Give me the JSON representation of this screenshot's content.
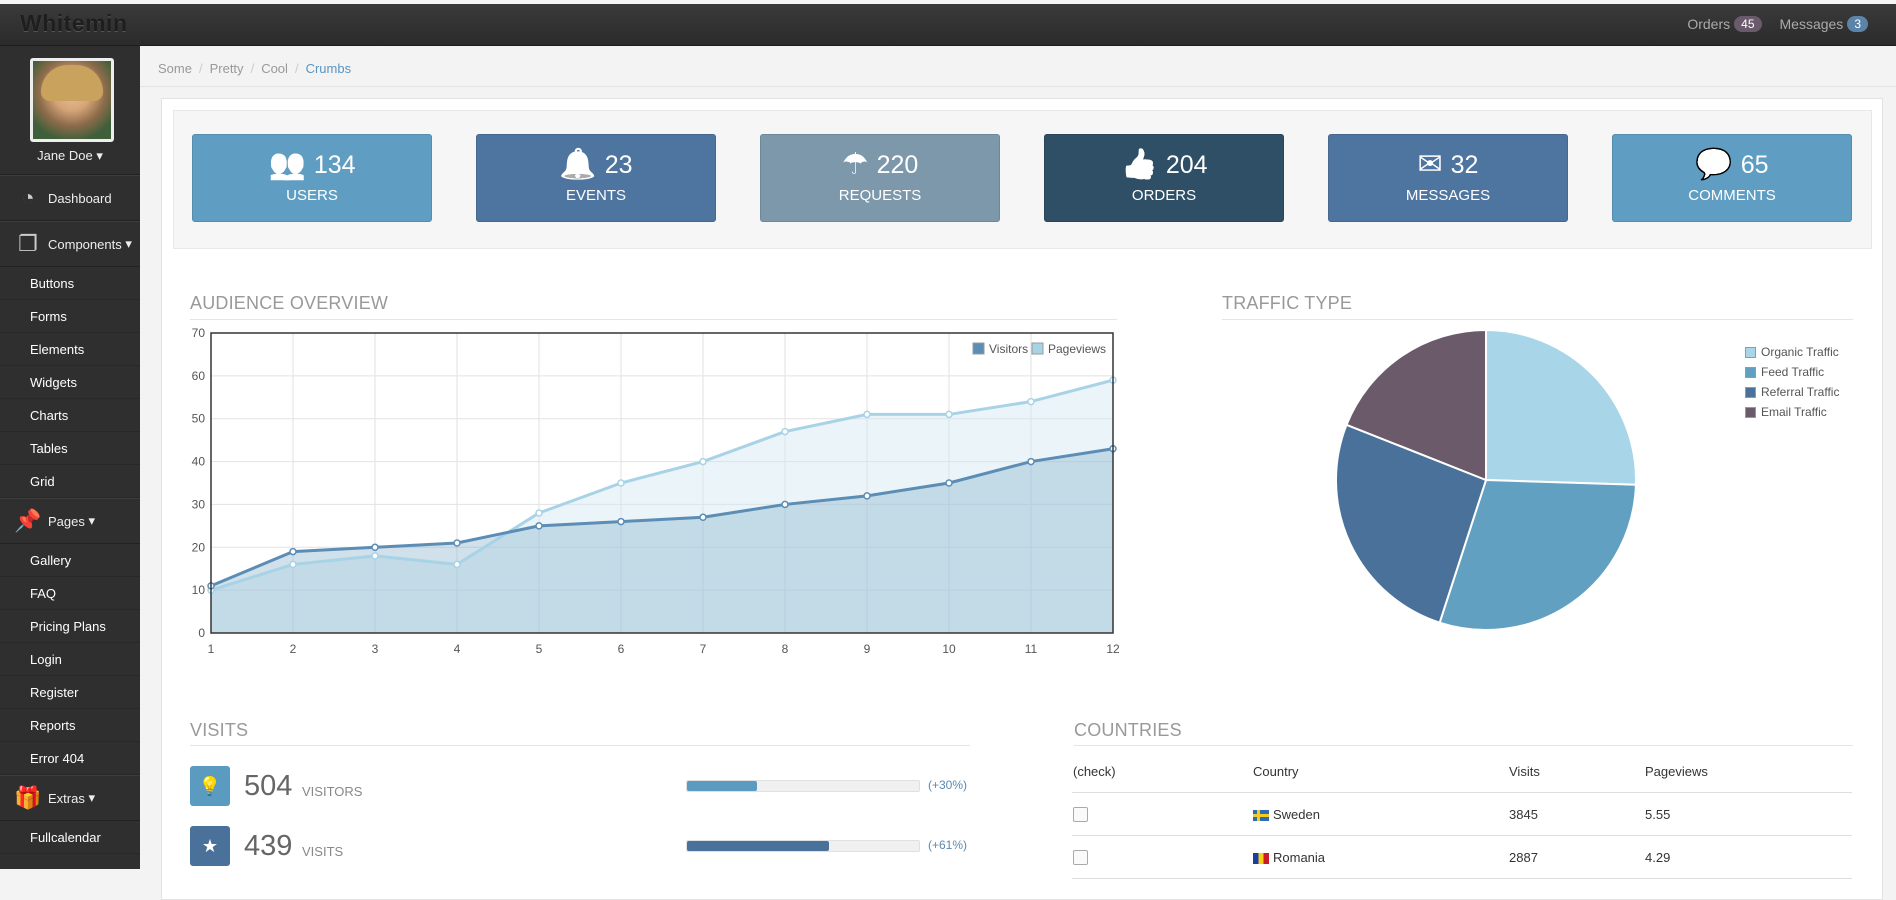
{
  "app": {
    "title": "Whitemin"
  },
  "topnav": {
    "orders": {
      "label": "Orders",
      "count": "45"
    },
    "messages": {
      "label": "Messages",
      "count": "3"
    }
  },
  "sidebar": {
    "user": "Jane Doe",
    "dashboard": "Dashboard",
    "components": "Components",
    "components_items": [
      "Buttons",
      "Forms",
      "Elements",
      "Widgets",
      "Charts",
      "Tables",
      "Grid"
    ],
    "pages": "Pages",
    "pages_items": [
      "Gallery",
      "FAQ",
      "Pricing Plans",
      "Login",
      "Register",
      "Reports",
      "Error 404"
    ],
    "extras": "Extras",
    "extras_items": [
      "Fullcalendar"
    ]
  },
  "breadcrumb": [
    "Some",
    "Pretty",
    "Cool",
    "Crumbs"
  ],
  "stats": [
    {
      "value": "134",
      "label": "USERS",
      "icon": "users-icon",
      "color": "#5f9dc2"
    },
    {
      "value": "23",
      "label": "EVENTS",
      "icon": "bell-icon",
      "color": "#4e74a0"
    },
    {
      "value": "220",
      "label": "REQUESTS",
      "icon": "umbrella-icon",
      "color": "#7c98aa"
    },
    {
      "value": "204",
      "label": "ORDERS",
      "icon": "thumbs-up-icon",
      "color": "#2e4f66"
    },
    {
      "value": "32",
      "label": "MESSAGES",
      "icon": "envelope-icon",
      "color": "#4e74a0"
    },
    {
      "value": "65",
      "label": "COMMENTS",
      "icon": "comments-icon",
      "color": "#5f9dc2"
    }
  ],
  "audience": {
    "title": "AUDIENCE OVERVIEW",
    "chart_data": {
      "type": "area",
      "x": [
        1,
        2,
        3,
        4,
        5,
        6,
        7,
        8,
        9,
        10,
        11,
        12
      ],
      "ylim": [
        0,
        70
      ],
      "yticks": [
        0,
        10,
        20,
        30,
        40,
        50,
        60,
        70
      ],
      "series": [
        {
          "name": "Visitors",
          "values": [
            11,
            19,
            20,
            21,
            25,
            26,
            27,
            30,
            32,
            35,
            40,
            43
          ],
          "color": "#5b8db5"
        },
        {
          "name": "Pageviews",
          "values": [
            10,
            16,
            18,
            16,
            28,
            35,
            40,
            47,
            51,
            51,
            54,
            59
          ],
          "color": "#a8d3e6"
        }
      ],
      "legend": "top-right",
      "grid": true
    }
  },
  "traffic": {
    "title": "TRAFFIC TYPE",
    "chart_data": {
      "type": "pie",
      "labels": [
        "Organic Traffic",
        "Feed Traffic",
        "Referral Traffic",
        "Email Traffic"
      ],
      "values": [
        25.5,
        29.5,
        26,
        19
      ],
      "colors": [
        "#a8d6e8",
        "#62a0c2",
        "#4a7199",
        "#6b5a69"
      ],
      "legend": "top-right"
    }
  },
  "visits": {
    "title": "VISITS",
    "rows": [
      {
        "value": "504",
        "label": "VISITORS",
        "pct": "(+30%)",
        "fill": 0.3,
        "icon": "lightbulb-icon",
        "color": "#5b9bbf"
      },
      {
        "value": "439",
        "label": "VISITS",
        "pct": "(+61%)",
        "fill": 0.61,
        "icon": "star-icon",
        "color": "#4a7199"
      }
    ]
  },
  "countries": {
    "title": "COUNTRIES",
    "headers": [
      "(check)",
      "Country",
      "Visits",
      "Pageviews"
    ],
    "rows": [
      {
        "country": "Sweden",
        "visits": "3845",
        "pageviews": "5.55"
      },
      {
        "country": "Romania",
        "visits": "2887",
        "pageviews": "4.29"
      }
    ]
  }
}
